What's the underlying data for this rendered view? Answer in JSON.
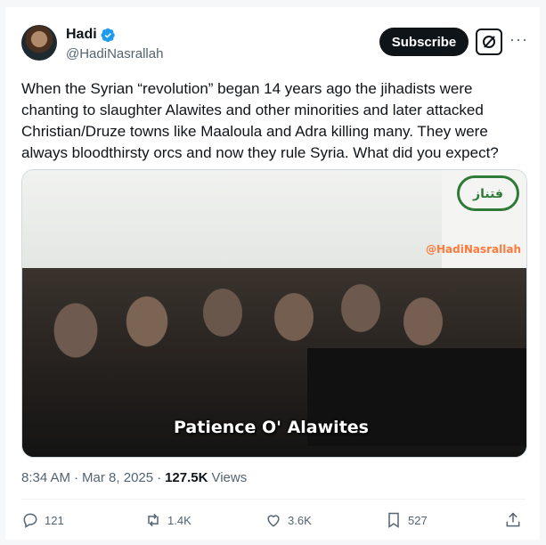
{
  "author": {
    "display_name": "Hadi",
    "handle": "@HadiNasrallah",
    "verified_icon": "verified-badge-icon"
  },
  "header": {
    "subscribe_label": "Subscribe",
    "grok_icon": "grok-icon",
    "more_icon": "more-icon"
  },
  "tweet": {
    "text": "When the Syrian “revolution” began 14 years ago the jihadists were chanting to slaughter Alawites and other minorities and later attacked Christian/Druze towns like Maaloula and Adra killing many. They were always bloodthirsty orcs and now they rule Syria. What did you expect?"
  },
  "media": {
    "watermark": "@HadiNasrallah",
    "caption": "Patience O' Alawites",
    "sign_text": "فتناز"
  },
  "meta": {
    "time": "8:34 AM",
    "separator1": "·",
    "date": "Mar 8, 2025",
    "separator2": "·",
    "views_count": "127.5K",
    "views_label": "Views"
  },
  "actions": {
    "replies": "121",
    "reposts": "1.4K",
    "likes": "3.6K",
    "bookmarks": "527"
  },
  "colors": {
    "accent": "#1d9bf0",
    "text": "#0f1419",
    "secondary": "#536471",
    "button_bg": "#0f1419"
  }
}
